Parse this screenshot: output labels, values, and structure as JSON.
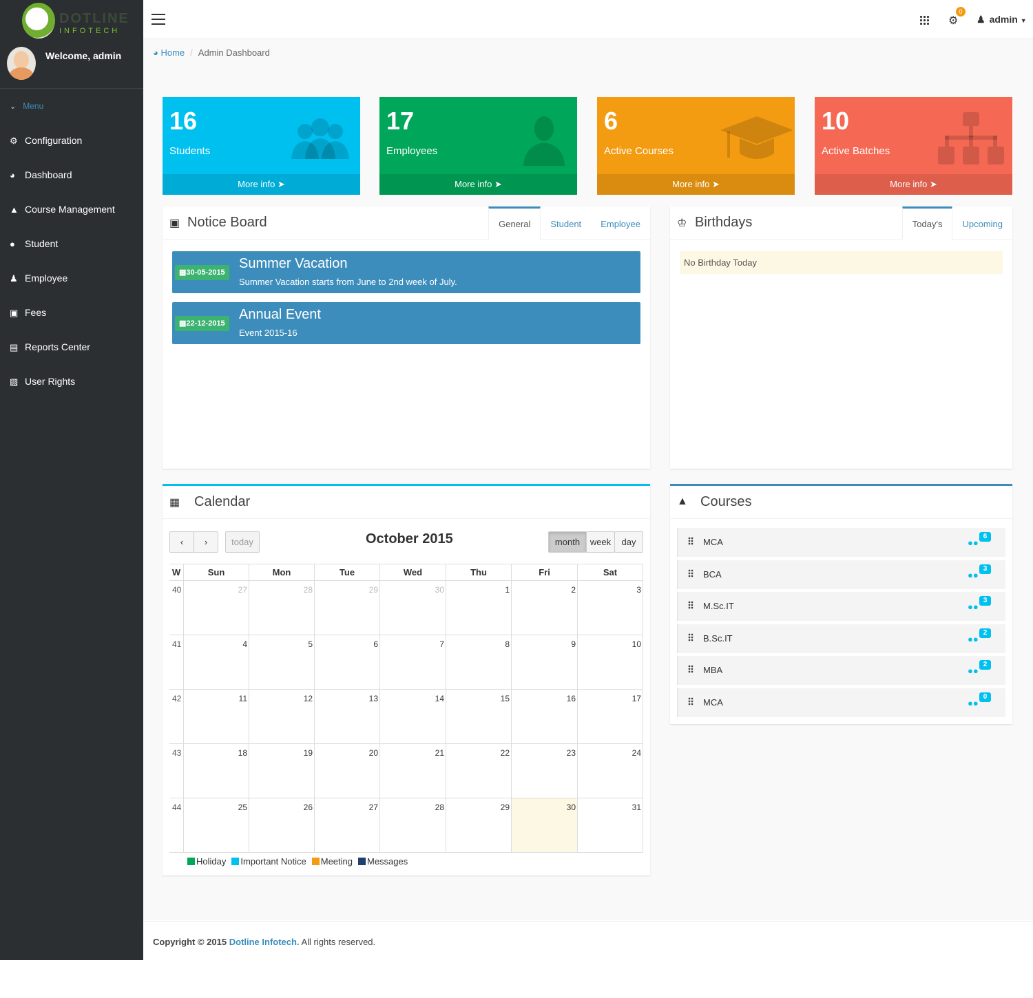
{
  "brand": {
    "name": "DOTLINE",
    "sub": "INFOTECH"
  },
  "user": {
    "welcome": "Welcome, admin",
    "name": "admin"
  },
  "sidebar": {
    "menu_label": "Menu",
    "items": [
      {
        "label": "Configuration",
        "icon": "gears-icon"
      },
      {
        "label": "Dashboard",
        "icon": "dashboard-icon"
      },
      {
        "label": "Course Management",
        "icon": "graduation-cap-icon"
      },
      {
        "label": "Student",
        "icon": "users-icon"
      },
      {
        "label": "Employee",
        "icon": "user-icon"
      },
      {
        "label": "Fees",
        "icon": "money-icon"
      },
      {
        "label": "Reports Center",
        "icon": "bar-chart-icon"
      },
      {
        "label": "User Rights",
        "icon": "lock-icon"
      }
    ]
  },
  "topbar": {
    "notification_count": "0"
  },
  "breadcrumb": {
    "home": "Home",
    "current": "Admin Dashboard"
  },
  "stats": [
    {
      "value": "16",
      "label": "Students",
      "more": "More info",
      "color": "#00c0ef"
    },
    {
      "value": "17",
      "label": "Employees",
      "more": "More info",
      "color": "#00a65a"
    },
    {
      "value": "6",
      "label": "Active Courses",
      "more": "More info",
      "color": "#f39c12"
    },
    {
      "value": "10",
      "label": "Active Batches",
      "more": "More info",
      "color": "#f56954"
    }
  ],
  "notice_board": {
    "title": "Notice Board",
    "tabs": [
      "General",
      "Student",
      "Employee"
    ],
    "notices": [
      {
        "date": "30-05-2015",
        "title": "Summer Vacation",
        "desc": "Summer Vacation starts from June to 2nd week of July."
      },
      {
        "date": "22-12-2015",
        "title": "Annual Event",
        "desc": "Event 2015-16"
      }
    ]
  },
  "birthdays": {
    "title": "Birthdays",
    "tabs": [
      "Today's",
      "Upcoming"
    ],
    "empty": "No Birthday Today"
  },
  "calendar": {
    "title": "Calendar",
    "month": "October 2015",
    "today_btn": "today",
    "views": [
      "month",
      "week",
      "day"
    ],
    "headers": [
      "W",
      "Sun",
      "Mon",
      "Tue",
      "Wed",
      "Thu",
      "Fri",
      "Sat"
    ],
    "weeks": [
      {
        "w": "40",
        "days": [
          "27",
          "28",
          "29",
          "30",
          "1",
          "2",
          "3"
        ]
      },
      {
        "w": "41",
        "days": [
          "4",
          "5",
          "6",
          "7",
          "8",
          "9",
          "10"
        ]
      },
      {
        "w": "42",
        "days": [
          "11",
          "12",
          "13",
          "14",
          "15",
          "16",
          "17"
        ]
      },
      {
        "w": "43",
        "days": [
          "18",
          "19",
          "20",
          "21",
          "22",
          "23",
          "24"
        ]
      },
      {
        "w": "44",
        "days": [
          "25",
          "26",
          "27",
          "28",
          "29",
          "30",
          "31"
        ]
      }
    ],
    "legend": [
      {
        "label": "Holiday",
        "color": "#00a65a"
      },
      {
        "label": "Important Notice",
        "color": "#00c0ef"
      },
      {
        "label": "Meeting",
        "color": "#f39c12"
      },
      {
        "label": "Messages",
        "color": "#1f3f6e"
      }
    ]
  },
  "courses": {
    "title": "Courses",
    "items": [
      {
        "name": "MCA",
        "count": "6"
      },
      {
        "name": "BCA",
        "count": "3"
      },
      {
        "name": "M.Sc.IT",
        "count": "3"
      },
      {
        "name": "B.Sc.IT",
        "count": "2"
      },
      {
        "name": "MBA",
        "count": "2"
      },
      {
        "name": "MCA",
        "count": "0"
      }
    ]
  },
  "footer": {
    "copyright": "Copyright © 2015",
    "company": "Dotline Infotech.",
    "rights": "All rights reserved."
  }
}
